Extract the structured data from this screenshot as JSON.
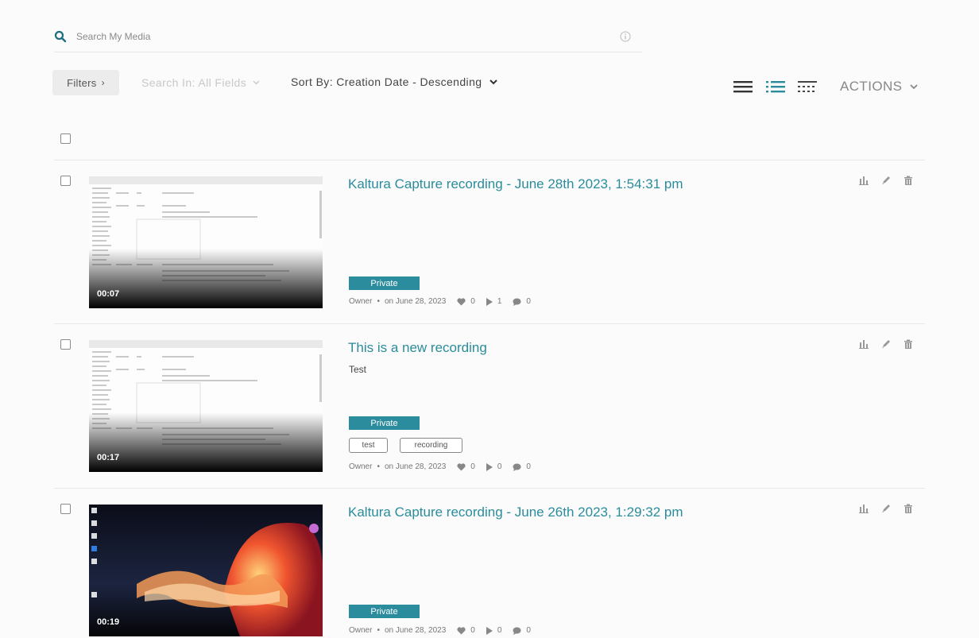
{
  "search": {
    "placeholder": "Search My Media"
  },
  "toolbar": {
    "filters_label": "Filters",
    "search_in_label": "Search In: All Fields",
    "sort_by_label": "Sort By: Creation Date - Descending",
    "actions_label": "ACTIONS",
    "active_view": "list-view"
  },
  "colors": {
    "accent": "#2a8c9c",
    "badge": "#2a8c9c"
  },
  "entries": [
    {
      "title": "Kaltura Capture recording - June 28th 2023, 1:54:31 pm",
      "description": "",
      "duration": "00:07",
      "status": "Private",
      "tags": [],
      "owner": "Owner",
      "date": "on June 28, 2023",
      "likes": "0",
      "plays": "1",
      "comments": "0"
    },
    {
      "title": "This is a new recording",
      "description": "Test",
      "duration": "00:17",
      "status": "Private",
      "tags": [
        "test",
        "recording"
      ],
      "owner": "Owner",
      "date": "on June 28, 2023",
      "likes": "0",
      "plays": "0",
      "comments": "0"
    },
    {
      "title": "Kaltura Capture recording - June 26th 2023, 1:29:32 pm",
      "description": "",
      "duration": "00:19",
      "status": "Private",
      "tags": [],
      "owner": "Owner",
      "date": "on June 28, 2023",
      "likes": "0",
      "plays": "0",
      "comments": "0"
    }
  ]
}
